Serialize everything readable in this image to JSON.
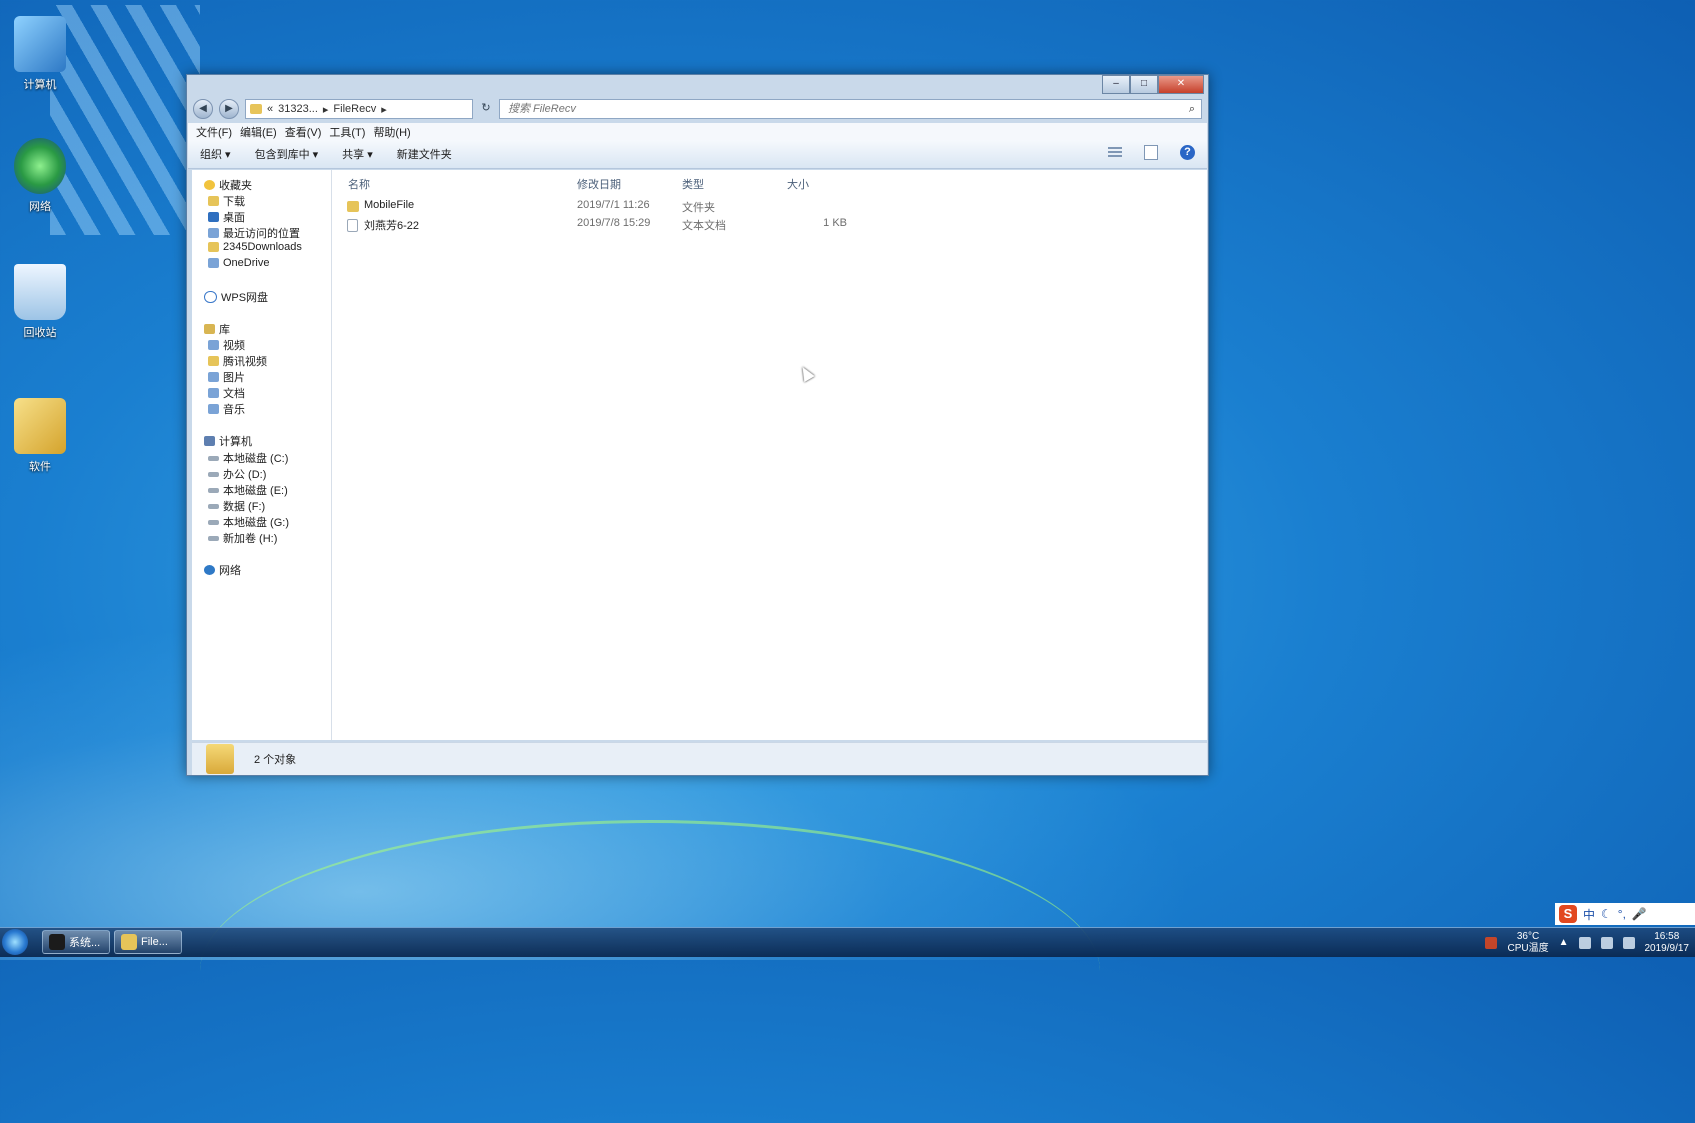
{
  "desktop": {
    "icons": [
      {
        "label": "计算机"
      },
      {
        "label": "网络"
      },
      {
        "label": "回收站"
      },
      {
        "label": "软件"
      }
    ]
  },
  "window": {
    "caption": {
      "minimize": "–",
      "maximize": "□",
      "close": "✕"
    },
    "address": {
      "prefix": "«",
      "crumb1": "31323...",
      "crumb2": "FileRecv",
      "sep": "▸"
    },
    "search": {
      "placeholder": "搜索 FileRecv"
    },
    "menu": [
      "文件(F)",
      "编辑(E)",
      "查看(V)",
      "工具(T)",
      "帮助(H)"
    ],
    "toolbar": {
      "organize": "组织 ▾",
      "include": "包含到库中 ▾",
      "share": "共享 ▾",
      "new_folder": "新建文件夹"
    },
    "nav": {
      "favorites": "收藏夹",
      "fav_items": [
        "下载",
        "桌面",
        "最近访问的位置",
        "2345Downloads",
        "OneDrive"
      ],
      "wps": "WPS网盘",
      "libraries": "库",
      "lib_items": [
        "视频",
        "腾讯视频",
        "图片",
        "文档",
        "音乐"
      ],
      "computer": "计算机",
      "drives": [
        "本地磁盘 (C:)",
        "办公 (D:)",
        "本地磁盘 (E:)",
        "数据 (F:)",
        "本地磁盘 (G:)",
        "新加卷 (H:)"
      ],
      "network": "网络"
    },
    "columns": {
      "name": "名称",
      "modified": "修改日期",
      "type": "类型",
      "size": "大小"
    },
    "files": [
      {
        "name": "MobileFile",
        "modified": "2019/7/1 11:26",
        "type": "文件夹",
        "size": ""
      },
      {
        "name": "刘燕芳6-22",
        "modified": "2019/7/8 15:29",
        "type": "文本文档",
        "size": "1 KB"
      }
    ],
    "status": "2 个对象"
  },
  "taskbar": {
    "buttons": [
      {
        "label": "系统..."
      },
      {
        "label": "File..."
      }
    ],
    "temp": "36°C",
    "temp_label": "CPU温度",
    "time": "16:58",
    "date": "2019/9/17"
  },
  "ime": {
    "mode": "中"
  }
}
